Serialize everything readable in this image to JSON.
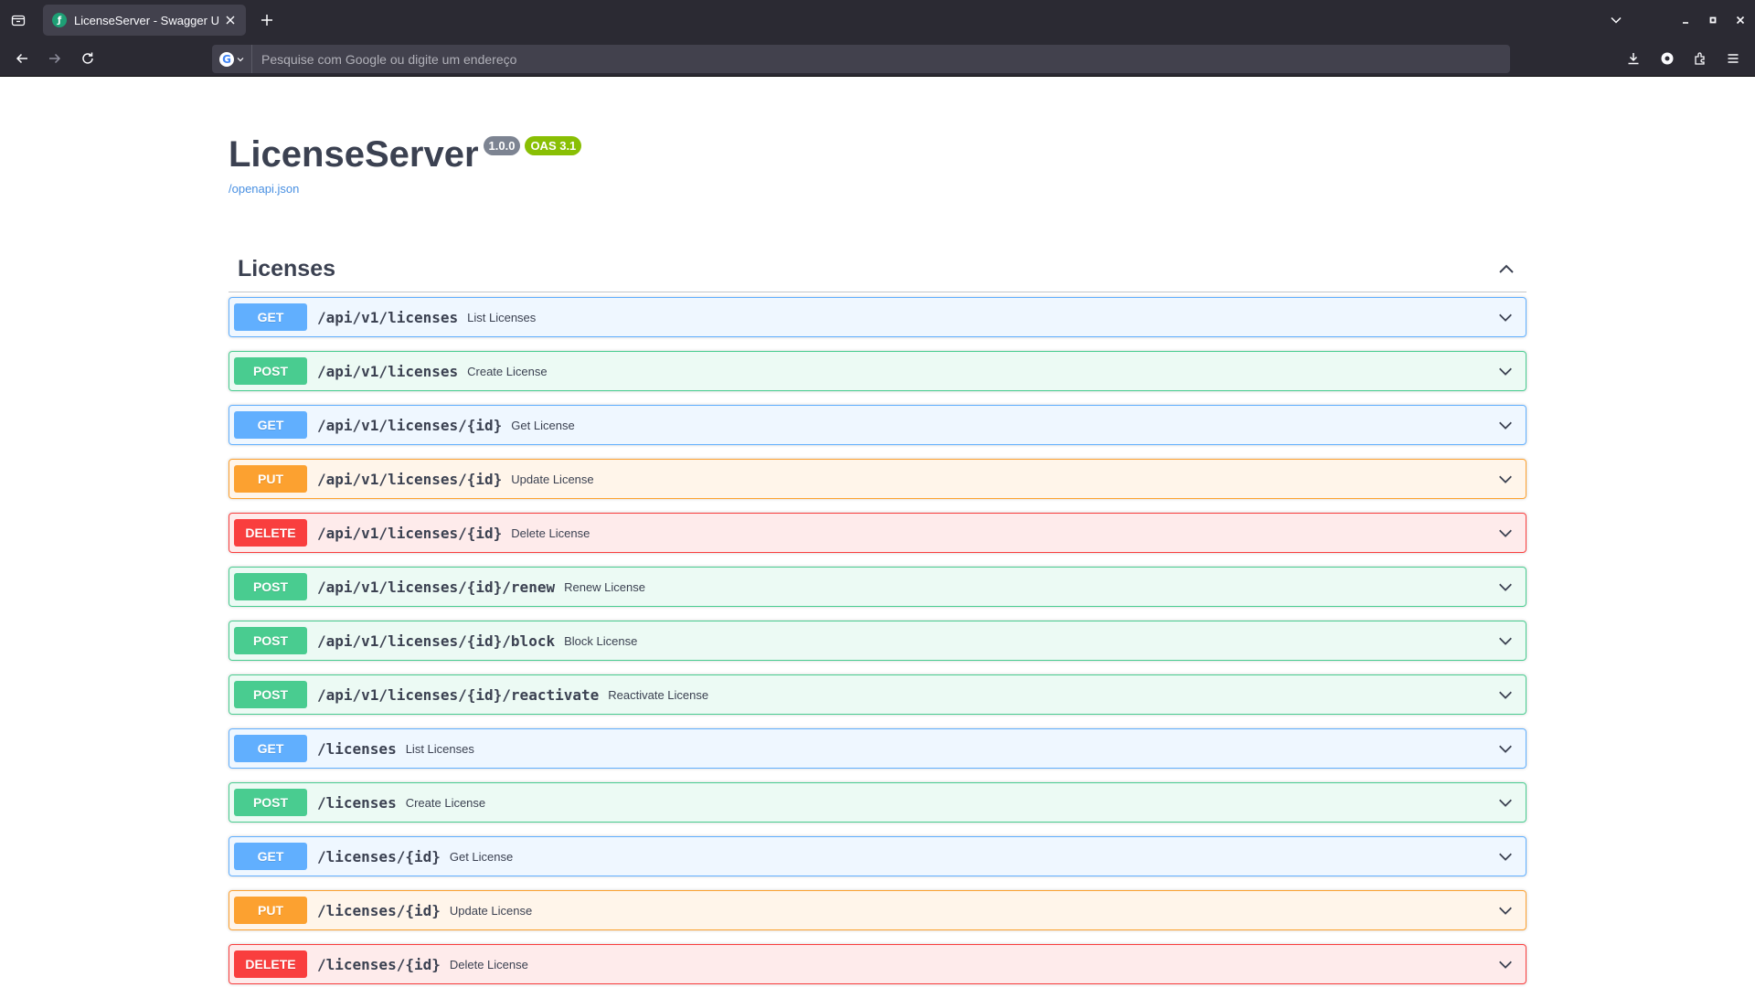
{
  "browser": {
    "tab_title": "LicenseServer - Swagger UI",
    "favicon_letter": "ƒ",
    "url_placeholder": "Pesquise com Google ou digite um endereço",
    "search_engine_letter": "G",
    "chrome_bg": "#2b2a33"
  },
  "api": {
    "title": "LicenseServer",
    "version": "1.0.0",
    "oas": "OAS 3.1",
    "spec_link": "/openapi.json"
  },
  "section": {
    "name": "Licenses",
    "expanded": true
  },
  "method_colors": {
    "GET": "#61affe",
    "POST": "#49cc90",
    "PUT": "#fca130",
    "DELETE": "#f93e3e"
  },
  "operations": [
    {
      "method": "GET",
      "path": "/api/v1/licenses",
      "summary": "List Licenses"
    },
    {
      "method": "POST",
      "path": "/api/v1/licenses",
      "summary": "Create License"
    },
    {
      "method": "GET",
      "path": "/api/v1/licenses/{id}",
      "summary": "Get License"
    },
    {
      "method": "PUT",
      "path": "/api/v1/licenses/{id}",
      "summary": "Update License"
    },
    {
      "method": "DELETE",
      "path": "/api/v1/licenses/{id}",
      "summary": "Delete License"
    },
    {
      "method": "POST",
      "path": "/api/v1/licenses/{id}/renew",
      "summary": "Renew License"
    },
    {
      "method": "POST",
      "path": "/api/v1/licenses/{id}/block",
      "summary": "Block License"
    },
    {
      "method": "POST",
      "path": "/api/v1/licenses/{id}/reactivate",
      "summary": "Reactivate License"
    },
    {
      "method": "GET",
      "path": "/licenses",
      "summary": "List Licenses"
    },
    {
      "method": "POST",
      "path": "/licenses",
      "summary": "Create License"
    },
    {
      "method": "GET",
      "path": "/licenses/{id}",
      "summary": "Get License"
    },
    {
      "method": "PUT",
      "path": "/licenses/{id}",
      "summary": "Update License"
    },
    {
      "method": "DELETE",
      "path": "/licenses/{id}",
      "summary": "Delete License"
    }
  ]
}
